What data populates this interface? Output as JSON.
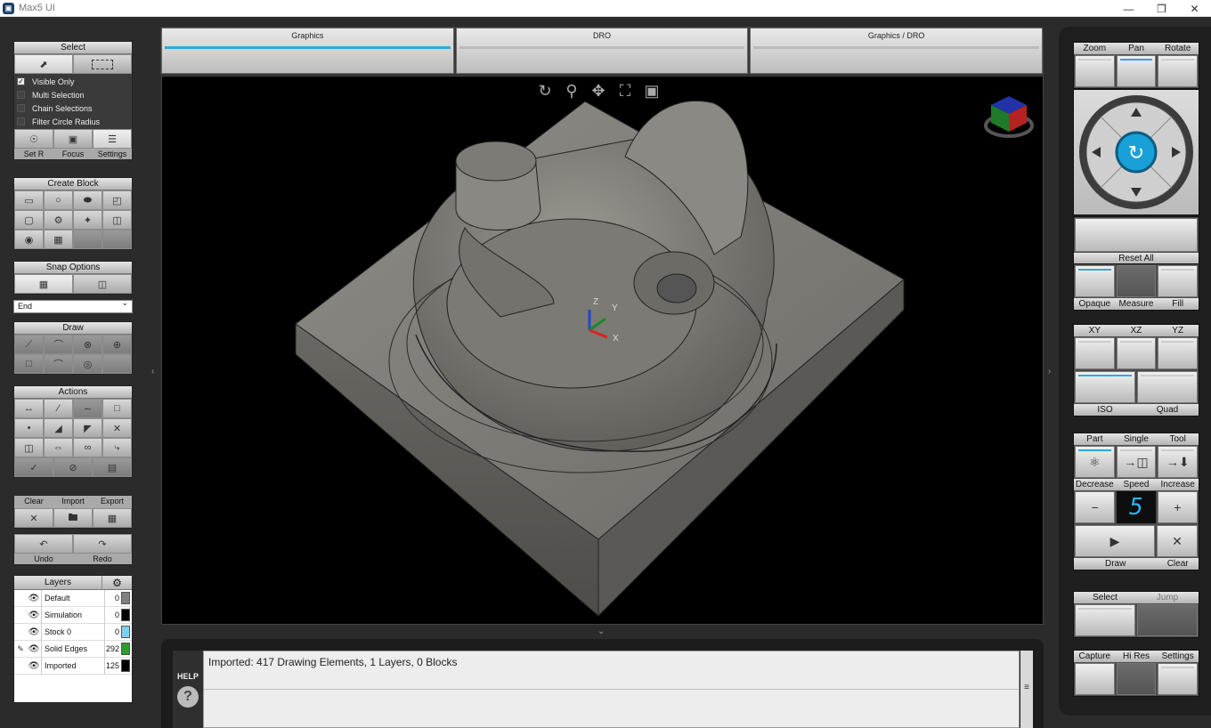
{
  "window": {
    "title": "Max5 UI"
  },
  "left": {
    "select": {
      "title": "Select",
      "options": [
        "Visible Only",
        "Multi Selection",
        "Chain Selections",
        "Filter Circle Radius"
      ],
      "checked": [
        true,
        false,
        false,
        false
      ],
      "bottom_labels": [
        "Set R",
        "Focus",
        "Settings"
      ]
    },
    "create_block": {
      "title": "Create Block"
    },
    "snap": {
      "title": "Snap Options",
      "mode": "End"
    },
    "draw": {
      "title": "Draw"
    },
    "actions": {
      "title": "Actions"
    },
    "file": {
      "labels": [
        "Clear",
        "Import",
        "Export"
      ]
    },
    "history": {
      "labels": [
        "Undo",
        "Redo"
      ]
    },
    "layers": {
      "title": "Layers",
      "rows": [
        {
          "name": "Default",
          "count": "0",
          "color": "#808080",
          "edit": false
        },
        {
          "name": "Simulation",
          "count": "0",
          "color": "#000000",
          "edit": false
        },
        {
          "name": "Stock 0",
          "count": "0",
          "color": "#7fd0f0",
          "edit": false
        },
        {
          "name": "Solid Edges",
          "count": "292",
          "color": "#2a9d2a",
          "edit": true
        },
        {
          "name": "Imported",
          "count": "125",
          "color": "#000000",
          "edit": false
        }
      ]
    }
  },
  "tabs": [
    {
      "label": "Graphics",
      "active": true
    },
    {
      "label": "DRO",
      "active": false
    },
    {
      "label": "Graphics / DRO",
      "active": false
    }
  ],
  "viewport": {
    "axes": {
      "x": "X",
      "y": "Y",
      "z": "Z"
    }
  },
  "help": {
    "label": "HELP"
  },
  "console": {
    "message": "Imported: 417 Drawing Elements, 1 Layers, 0 Blocks"
  },
  "right": {
    "view_mode": {
      "labels": [
        "Zoom",
        "Pan",
        "Rotate"
      ],
      "active": "Pan"
    },
    "reset": "Reset All",
    "display": {
      "labels": [
        "Opaque",
        "Measure",
        "Fill"
      ]
    },
    "planes": {
      "labels": [
        "XY",
        "XZ",
        "YZ"
      ]
    },
    "projection": {
      "labels": [
        "ISO",
        "Quad"
      ]
    },
    "sim_mode": {
      "labels": [
        "Part",
        "Single",
        "Tool"
      ]
    },
    "speed": {
      "labels": [
        "Decrease",
        "Speed",
        "Increase"
      ],
      "value": "5"
    },
    "draw_clear": {
      "labels": [
        "Draw",
        "Clear"
      ]
    },
    "select_jump": {
      "labels": [
        "Select",
        "Jump"
      ]
    },
    "capture": {
      "labels": [
        "Capture",
        "Hi Res",
        "Settings"
      ]
    }
  }
}
